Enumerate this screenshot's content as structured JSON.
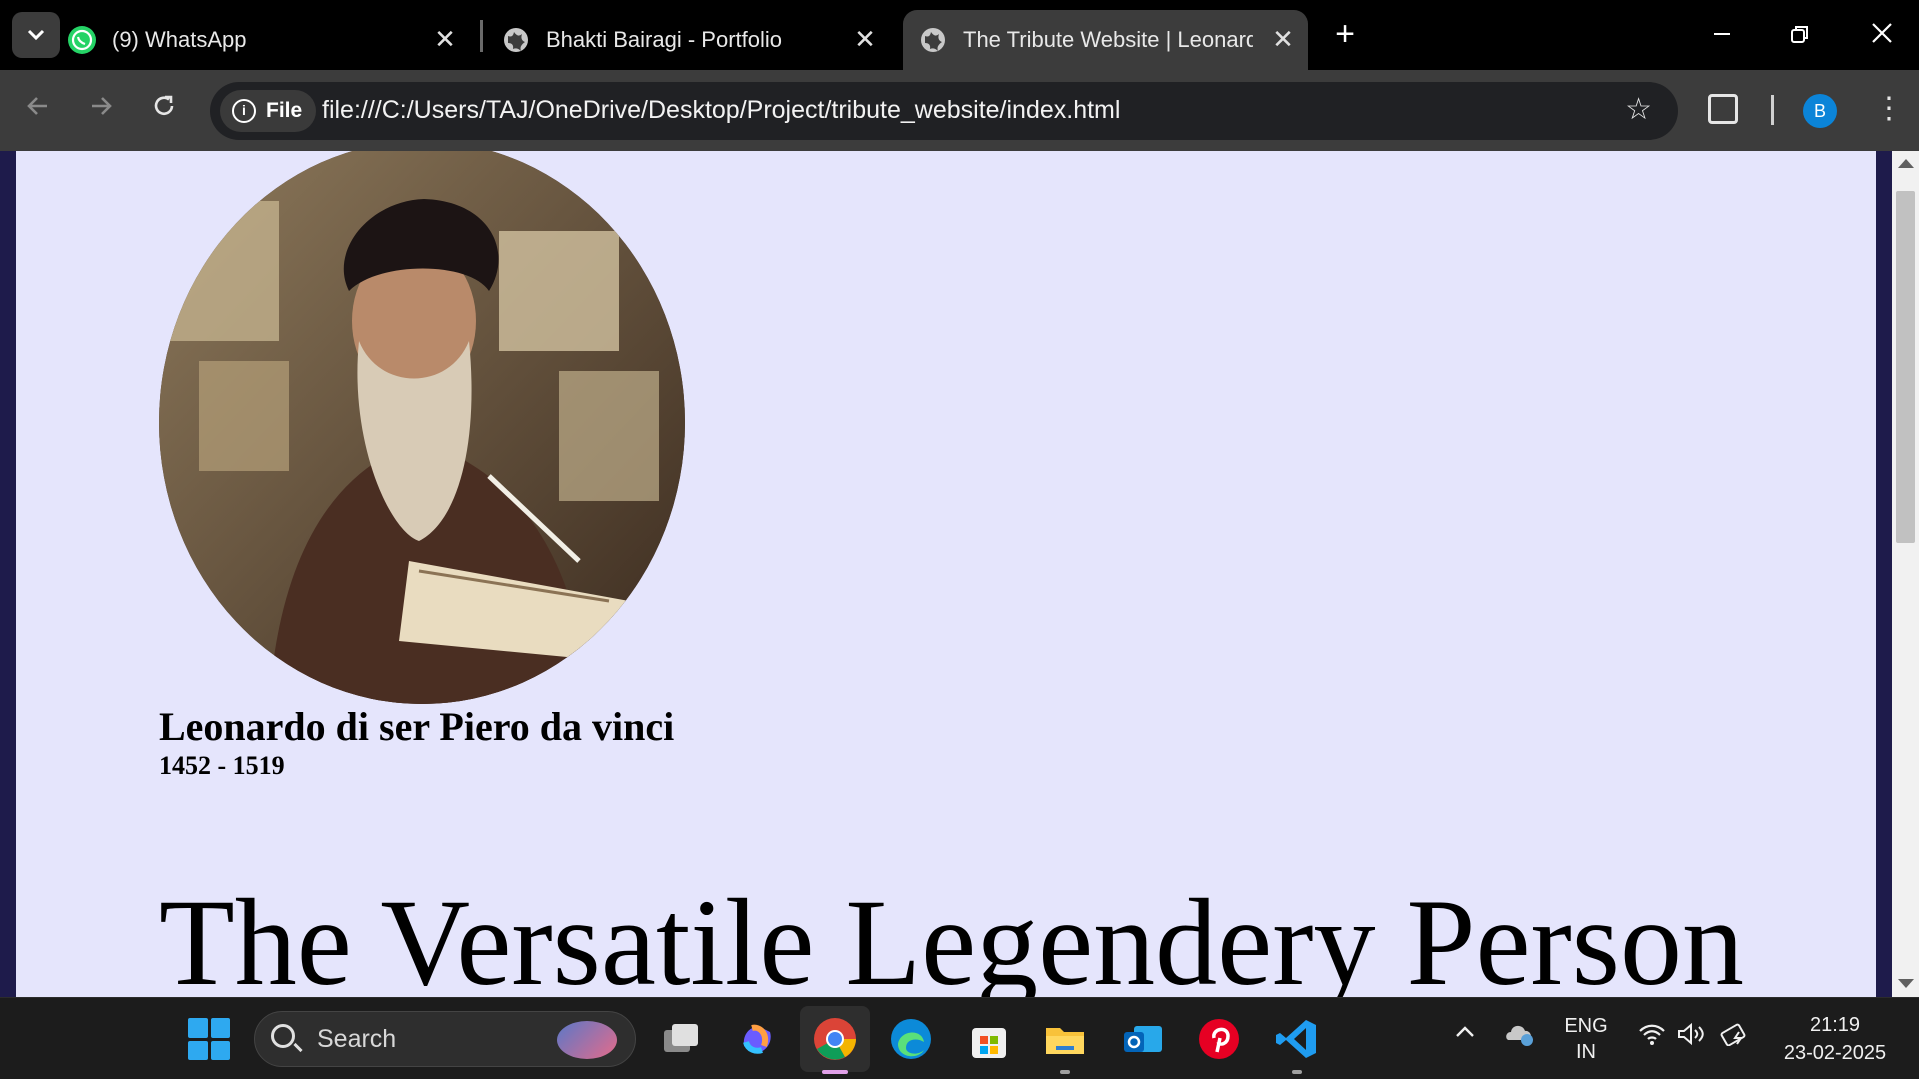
{
  "browser": {
    "tabs": [
      {
        "label": "(9) WhatsApp",
        "icon": "whatsapp-icon"
      },
      {
        "label": "Bhakti Bairagi - Portfolio",
        "icon": "globe-icon"
      },
      {
        "label": "The Tribute Website | Leonardo",
        "icon": "globe-icon",
        "active": true
      }
    ],
    "site_chip": "File",
    "url": "file:///C:/Users/TAJ/OneDrive/Desktop/Project/tribute_website/index.html",
    "profile_initial": "B"
  },
  "page": {
    "person_name": "Leonardo di ser Piero da vinci",
    "years": "1452 - 1519",
    "hero_title": "The Versatile Legendery Person"
  },
  "taskbar": {
    "search_placeholder": "Search",
    "apps": [
      "file-explorer-icon-task-view",
      "copilot-icon",
      "chrome-icon",
      "edge-icon",
      "store-icon",
      "file-explorer-icon",
      "outlook-icon",
      "pinterest-icon",
      "vscode-icon"
    ],
    "language_line1": "ENG",
    "language_line2": "IN",
    "time": "21:19",
    "date": "23-02-2025"
  },
  "colors": {
    "page_background": "#e5e5fc",
    "page_border": "#1e1b4b",
    "whatsapp": "#25d366",
    "profile": "#0b84d8"
  }
}
